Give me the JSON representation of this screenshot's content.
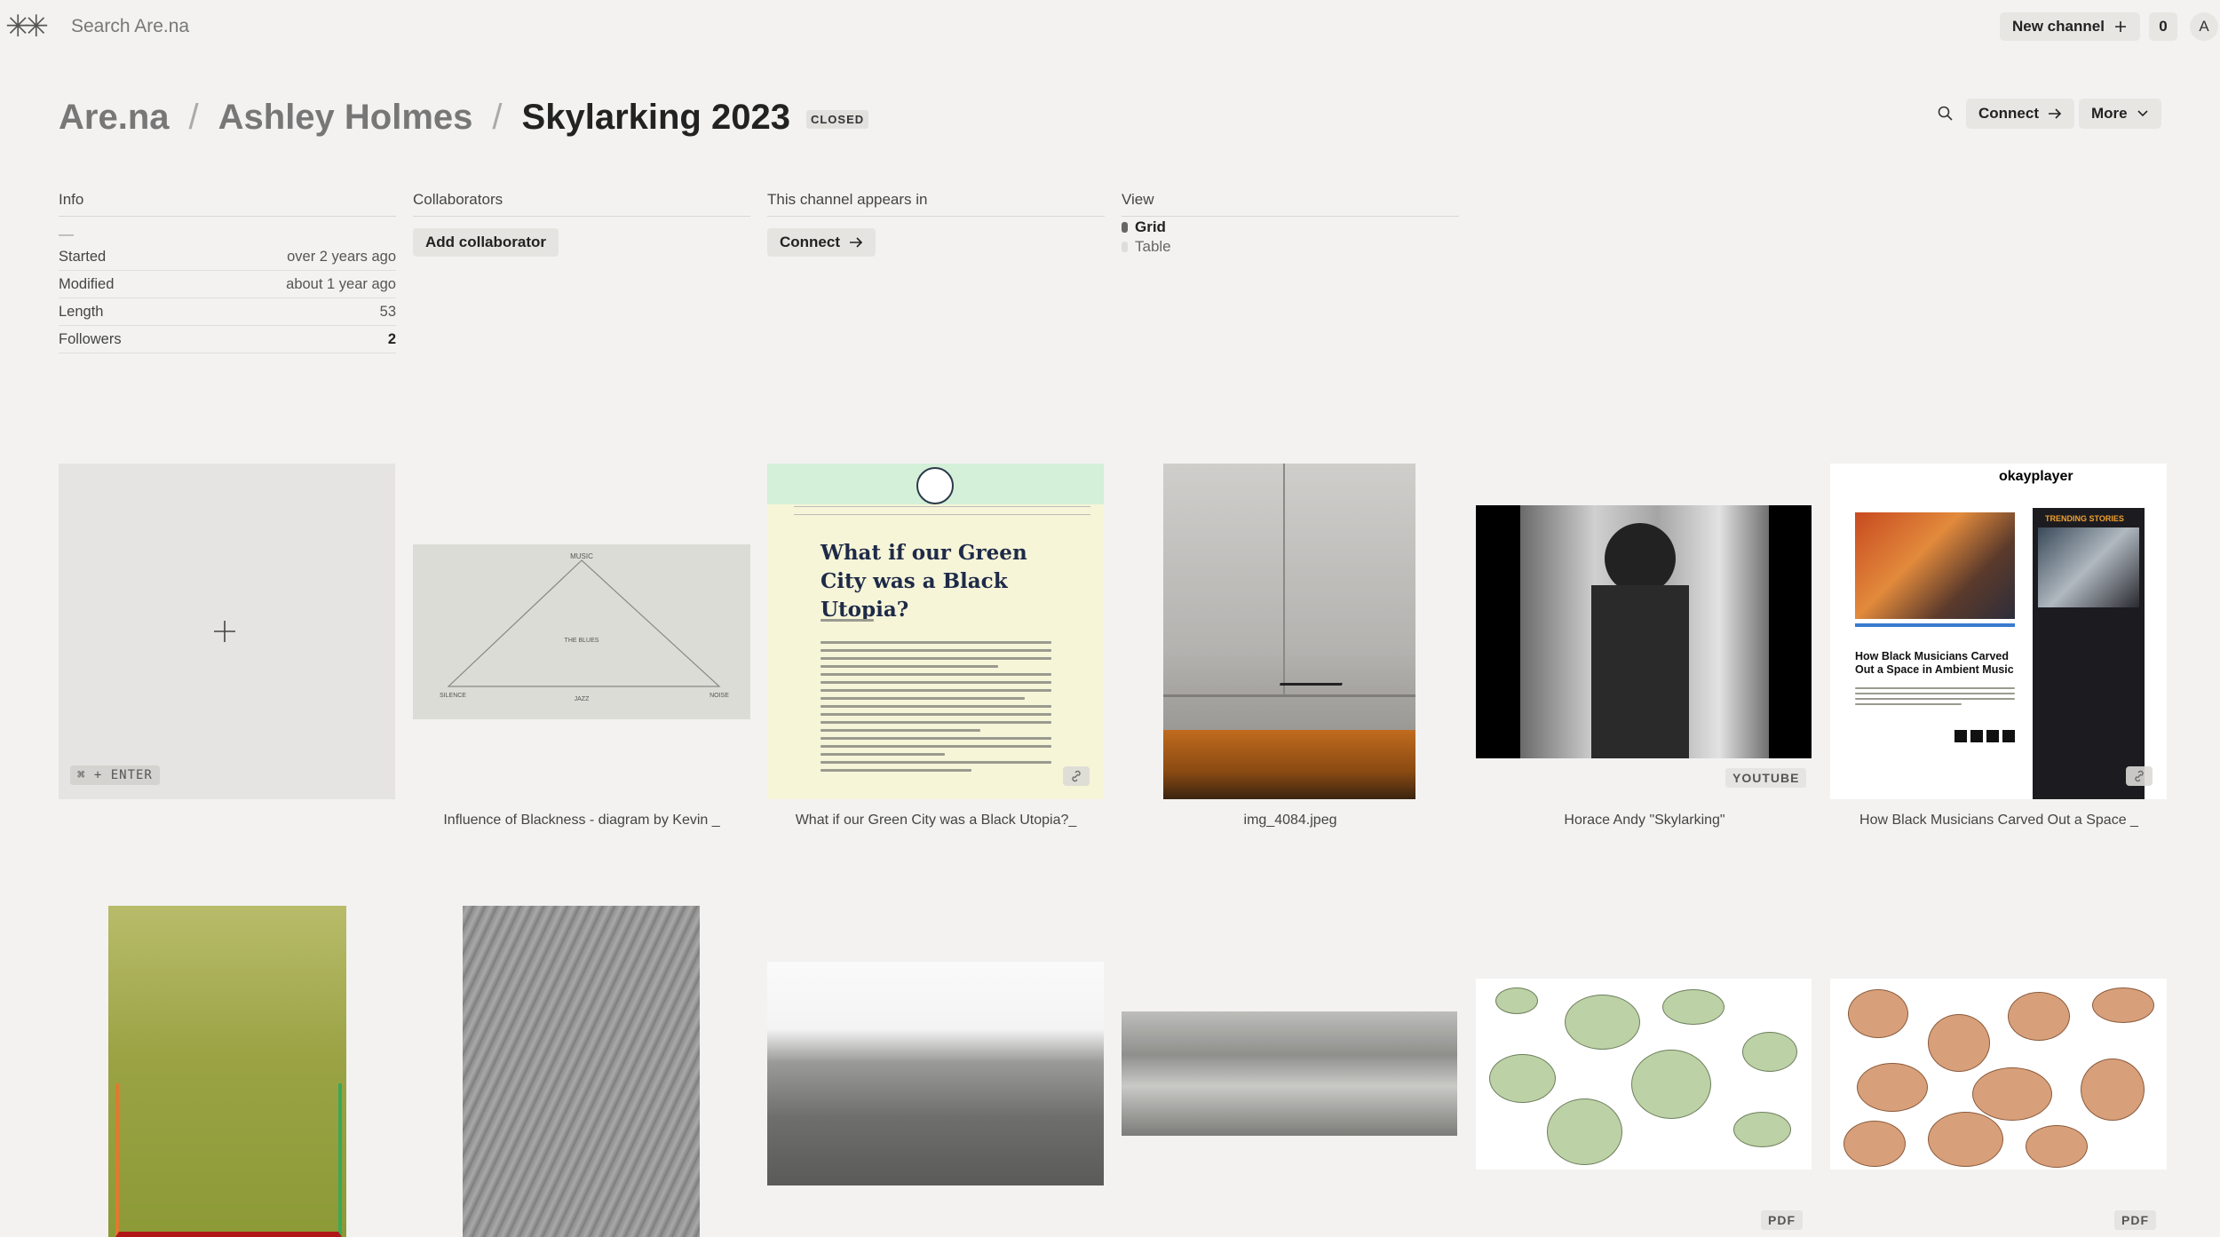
{
  "topbar": {
    "search_placeholder": "Search Are.na",
    "new_channel_label": "New channel",
    "notification_count": "0",
    "avatar_initial": "A"
  },
  "breadcrumb": {
    "root": "Are.na",
    "user": "Ashley Holmes",
    "channel": "Skylarking 2023",
    "status_badge": "CLOSED"
  },
  "actions": {
    "connect_label": "Connect",
    "more_label": "More"
  },
  "info": {
    "heading": "Info",
    "description": "—",
    "rows": [
      {
        "label": "Started",
        "value": "over 2 years ago"
      },
      {
        "label": "Modified",
        "value": "about 1 year ago"
      },
      {
        "label": "Length",
        "value": "53"
      },
      {
        "label": "Followers",
        "value": "2"
      }
    ]
  },
  "collaborators": {
    "heading": "Collaborators",
    "add_label": "Add collaborator"
  },
  "appears_in": {
    "heading": "This channel appears in",
    "connect_label": "Connect"
  },
  "view": {
    "heading": "View",
    "options": [
      "Grid",
      "Table"
    ],
    "selected": "Grid"
  },
  "add_block": {
    "shortcut": "⌘ + ENTER"
  },
  "blocks": [
    {
      "caption": "Influence of Blackness - diagram by Kevin _"
    },
    {
      "caption": "What if our Green City was a Black Utopia?_",
      "headline": "What if our Green City was a Black Utopia?"
    },
    {
      "caption": "img_4084.jpeg"
    },
    {
      "caption": "Horace Andy \"Skylarking\"",
      "badge": "YOUTUBE"
    },
    {
      "caption": "How Black Musicians Carved Out a Space _",
      "brand": "okayplayer",
      "headline": "How Black Musicians Carved Out a Space in Ambient Music",
      "side_label": "TRENDING STORIES"
    },
    {
      "caption": ""
    },
    {
      "caption": ""
    },
    {
      "caption": ""
    },
    {
      "caption": ""
    },
    {
      "caption": "",
      "badge": "PDF"
    },
    {
      "caption": "",
      "badge": "PDF"
    }
  ],
  "diagram_labels": {
    "top": "MUSIC",
    "left": "SILENCE",
    "right": "NOISE",
    "bottom": "JAZZ",
    "center": "THE BLUES"
  },
  "colors": {
    "background": "#f3f2f1",
    "button": "#e8e6e3",
    "accent_navy": "#1e2a48"
  }
}
